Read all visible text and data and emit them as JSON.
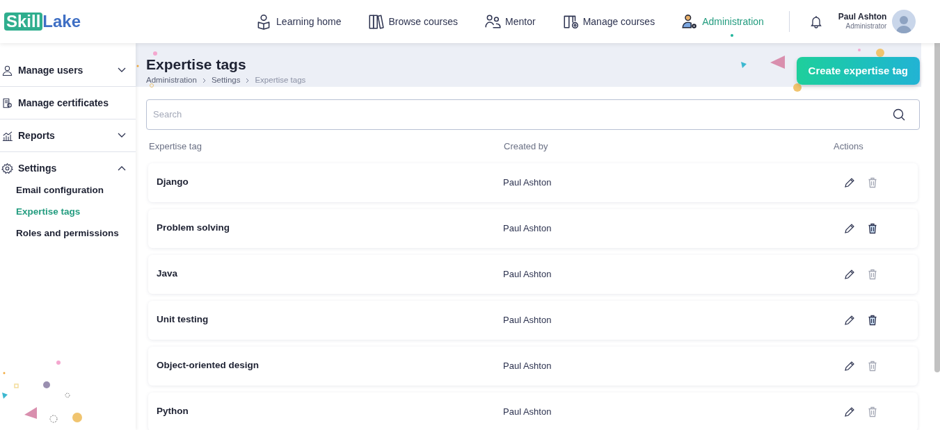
{
  "logo": {
    "part1": "Skill",
    "part2": "Lake"
  },
  "nav": [
    {
      "label": "Learning home",
      "selected": false
    },
    {
      "label": "Browse courses",
      "selected": false
    },
    {
      "label": "Mentor",
      "selected": false
    },
    {
      "label": "Manage courses",
      "selected": false
    },
    {
      "label": "Administration",
      "selected": true
    }
  ],
  "user": {
    "name": "Paul Ashton",
    "role": "Administrator"
  },
  "sidebar": {
    "items": [
      {
        "label": "Manage users",
        "kind": "group",
        "expanded": false
      },
      {
        "label": "Manage certificates",
        "kind": "link"
      },
      {
        "label": "Reports",
        "kind": "group",
        "expanded": false
      },
      {
        "label": "Settings",
        "kind": "group",
        "expanded": true,
        "children": [
          {
            "label": "Email configuration",
            "selected": false
          },
          {
            "label": "Expertise tags",
            "selected": true
          },
          {
            "label": "Roles and permissions",
            "selected": false
          }
        ]
      }
    ]
  },
  "page": {
    "title": "Expertise tags",
    "breadcrumbs": [
      "Administration",
      "Settings",
      "Expertise tags"
    ],
    "create_button": "Create expertise tag"
  },
  "search": {
    "placeholder": "Search"
  },
  "table": {
    "columns": [
      "Expertise tag",
      "Created by",
      "Actions"
    ],
    "rows": [
      {
        "tag": "Django",
        "created_by": "Paul Ashton",
        "delete_disabled": true
      },
      {
        "tag": "Problem solving",
        "created_by": "Paul Ashton",
        "delete_disabled": false
      },
      {
        "tag": "Java",
        "created_by": "Paul Ashton",
        "delete_disabled": true
      },
      {
        "tag": "Unit testing",
        "created_by": "Paul Ashton",
        "delete_disabled": false
      },
      {
        "tag": "Object-oriented design",
        "created_by": "Paul Ashton",
        "delete_disabled": true
      },
      {
        "tag": "Python",
        "created_by": "Paul Ashton",
        "delete_disabled": true
      }
    ]
  }
}
